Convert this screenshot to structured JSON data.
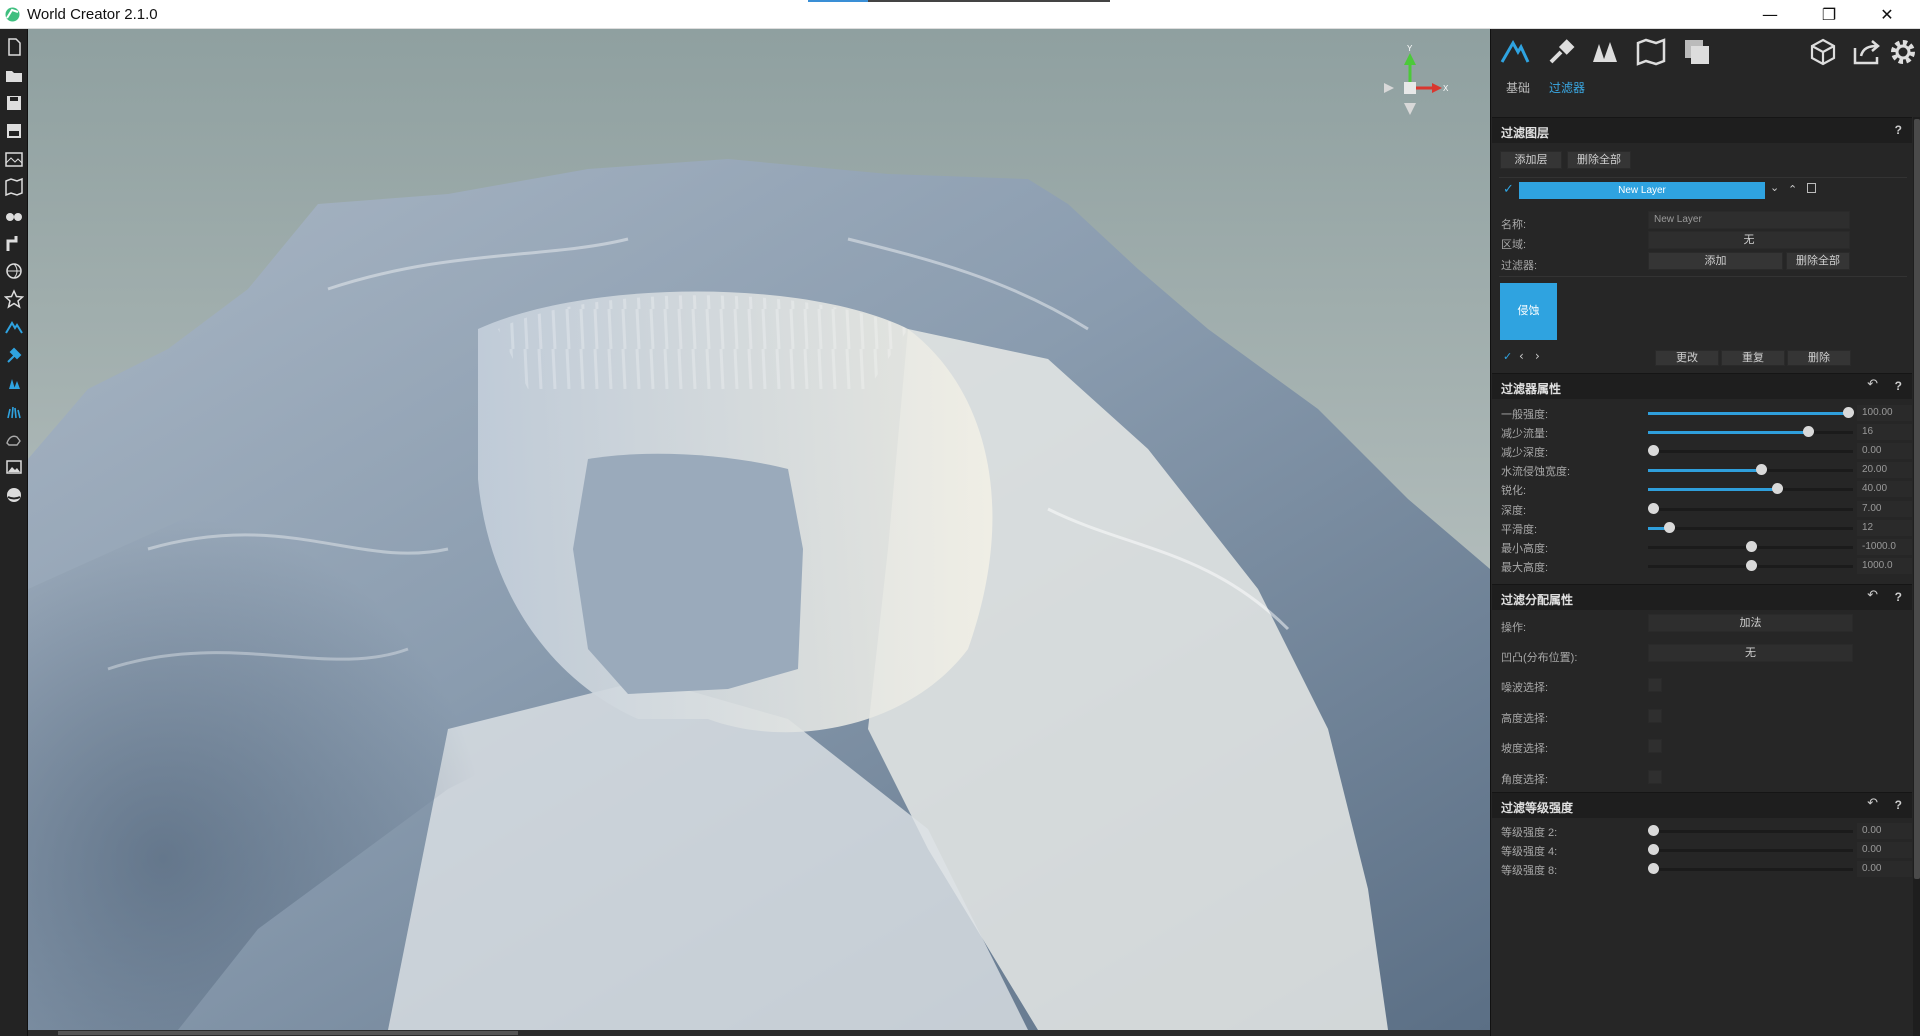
{
  "app": {
    "title": "World Creator 2.1.0",
    "icon": "world-creator-logo-icon"
  },
  "window_controls": {
    "minimize": "—",
    "maximize": "❐",
    "close": "✕"
  },
  "left_toolbar": [
    "new-file-icon",
    "open-folder-icon",
    "save-icon",
    "save-as-icon",
    "import-terrain-icon",
    "map-icon",
    "binoculars-icon",
    "pipe-icon",
    "globe-icon",
    "star-shape-icon",
    "terrain-tool-icon",
    "hammer-tool-icon",
    "vegetation-icon",
    "grass-icon",
    "animal-icon",
    "image-icon",
    "sphere-icon"
  ],
  "viewport": {
    "gizmo": {
      "y_label": "Y",
      "x_label": "X",
      "colors": {
        "x": "#d9372f",
        "y": "#4cc93a",
        "z": "#d8d8d8"
      }
    }
  },
  "panel": {
    "top_icons_left": [
      "terrain-mode-icon",
      "brush-tool-icon",
      "forest-icon",
      "map-mode-icon",
      "layers-icon"
    ],
    "top_icons_right": [
      "cube-icon",
      "export-icon",
      "settings-gear-icon"
    ],
    "tabs": {
      "basic": "基础",
      "filter": "过滤器",
      "active": "filter"
    },
    "filter_layers": {
      "title": "过滤图层",
      "help": "?",
      "add_layer": "添加层",
      "delete_all": "删除全部",
      "layer_name": "New Layer",
      "name_label": "名称:",
      "name_value": "New Layer",
      "region_label": "区域:",
      "region_value": "无",
      "filter_label": "过滤器:",
      "filter_add": "添加",
      "filter_delete_all": "删除全部",
      "filter_tile": "侵蚀",
      "change": "更改",
      "repeat": "重复",
      "delete": "删除"
    },
    "filter_props": {
      "title": "过滤器属性",
      "help": "?",
      "sliders": [
        {
          "label": "一般强度:",
          "value": "100.00",
          "fraction": 1.0,
          "fill": true
        },
        {
          "label": "减少流量:",
          "value": "16",
          "fraction": 0.78,
          "fill": true
        },
        {
          "label": "减少深度:",
          "value": "0.00",
          "fraction": 0.0,
          "fill": false
        },
        {
          "label": "水流侵蚀宽度:",
          "value": "20.00",
          "fraction": 0.55,
          "fill": true
        },
        {
          "label": "锐化:",
          "value": "40.00",
          "fraction": 0.63,
          "fill": true
        },
        {
          "label": "深度:",
          "value": "7.00",
          "fraction": 0.0,
          "fill": false
        },
        {
          "label": "平滑度:",
          "value": "12",
          "fraction": 0.1,
          "fill": true
        },
        {
          "label": "最小高度:",
          "value": "-1000.0",
          "fraction": 0.5,
          "fill": false
        },
        {
          "label": "最大高度:",
          "value": "1000.0",
          "fraction": 0.5,
          "fill": false
        }
      ]
    },
    "distribution": {
      "title": "过滤分配属性",
      "help": "?",
      "operation_label": "操作:",
      "operation_value": "加法",
      "bump_label": "凹凸(分布位置):",
      "bump_value": "无",
      "checks": [
        "噪波选择:",
        "高度选择:",
        "坡度选择:",
        "角度选择:"
      ]
    },
    "level_strength": {
      "title": "过滤等级强度",
      "help": "?",
      "sliders": [
        {
          "label": "等级强度 2:",
          "value": "0.00",
          "fraction": 0.0
        },
        {
          "label": "等级强度 4:",
          "value": "0.00",
          "fraction": 0.0
        },
        {
          "label": "等级强度 8:",
          "value": "0.00",
          "fraction": 0.0
        }
      ]
    },
    "accent_color": "#2fa3e0"
  }
}
